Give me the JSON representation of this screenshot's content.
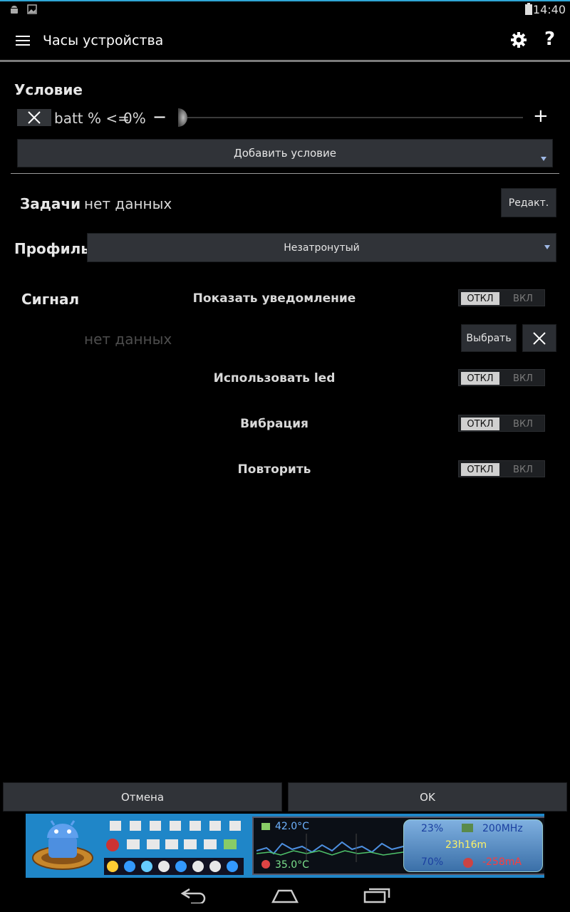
{
  "status_bar": {
    "time": "14:40",
    "icons": [
      "android-icon",
      "image-icon",
      "battery-icon"
    ]
  },
  "action_bar": {
    "title": "Часы устройства",
    "icons": [
      "menu-icon",
      "gear-icon",
      "help-icon"
    ],
    "help_glyph": "?"
  },
  "condition": {
    "heading": "Условие",
    "item": {
      "label": "batt % <=",
      "value": "0%",
      "minus": "−",
      "plus": "+",
      "slider_value": 0
    },
    "add_button": "Добавить условие"
  },
  "tasks": {
    "heading": "Задачи",
    "value": "нет данных",
    "edit_button": "Редакт."
  },
  "profile": {
    "heading": "Профиль",
    "selected": "Незатронутый"
  },
  "signal": {
    "heading": "Сигнал",
    "notification": {
      "label": "Показать уведомление",
      "off": "ОТКЛ",
      "on": "ВКЛ"
    },
    "sound": {
      "value": "нет данных",
      "choose_button": "Выбрать"
    },
    "led": {
      "label": "Использовать led",
      "off": "ОТКЛ",
      "on": "ВКЛ"
    },
    "vibration": {
      "label": "Вибрация",
      "off": "ОТКЛ",
      "on": "ВКЛ"
    },
    "repeat": {
      "label": "Повторить",
      "off": "ОТКЛ",
      "on": "ВКЛ"
    }
  },
  "footer": {
    "cancel": "Отмена",
    "ok": "OK"
  },
  "ad_banner": {
    "cpu_temp": "42.0°C",
    "battery_temp": "35.0°C",
    "battery_pct": "23%",
    "cpu_freq": "200MHz",
    "uptime": "23h16m",
    "cpu_load": "70%",
    "current": "-258mA"
  },
  "nav_bar": {
    "icons": [
      "back-icon",
      "home-icon",
      "recent-apps-icon"
    ]
  },
  "colors": {
    "accent": "#2fa6d6",
    "button_bg": "#303338",
    "dropdown_arrow": "#9fb9e6"
  }
}
